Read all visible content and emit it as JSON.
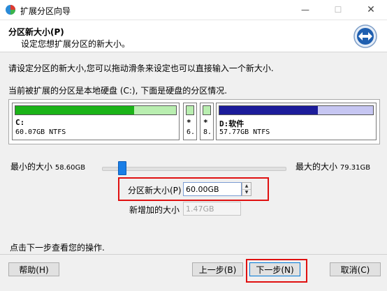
{
  "window": {
    "title": "扩展分区向导",
    "controls": {
      "minimize": "—",
      "maximize": "☐",
      "close": "✕"
    }
  },
  "header": {
    "title": "分区新大小(P)",
    "subtitle": "设定您想扩展分区的新大小。",
    "icon": "double-arrow-nav-icon"
  },
  "instructions": {
    "line1": "请设定分区的新大小,您可以拖动滑条来设定也可以直接输入一个新大小.",
    "line2": "当前被扩展的分区是本地硬盘 (C:), 下面是硬盘的分区情况."
  },
  "disk_map": {
    "partitions": [
      {
        "label": "C:",
        "detail": "60.07GB NTFS",
        "used_fraction": 0.74,
        "color": "green"
      },
      {
        "label": "*",
        "detail": "6.",
        "used_fraction": 0.0,
        "color": "green"
      },
      {
        "label": "*",
        "detail": "8.",
        "used_fraction": 0.0,
        "color": "green"
      },
      {
        "label": "D:软件",
        "detail": "57.77GB NTFS",
        "used_fraction": 0.64,
        "color": "blue"
      }
    ]
  },
  "size_range": {
    "min_label": "最小的大小",
    "min_value": "58.60GB",
    "max_label": "最大的大小",
    "max_value": "79.31GB",
    "slider_value_gb": 60.0
  },
  "new_size": {
    "label": "分区新大小(P)",
    "value": "60.00GB"
  },
  "increase": {
    "label": "新增加的大小",
    "value": "1.47GB"
  },
  "footer_hint": "点击下一步查看您的操作.",
  "buttons": {
    "help": "帮助(H)",
    "back": "上一步(B)",
    "next": "下一步(N)",
    "cancel": "取消(C)"
  },
  "colors": {
    "green_fill": "#1bb318",
    "blue_fill": "#1c1c9a",
    "highlight": "#e01010"
  }
}
